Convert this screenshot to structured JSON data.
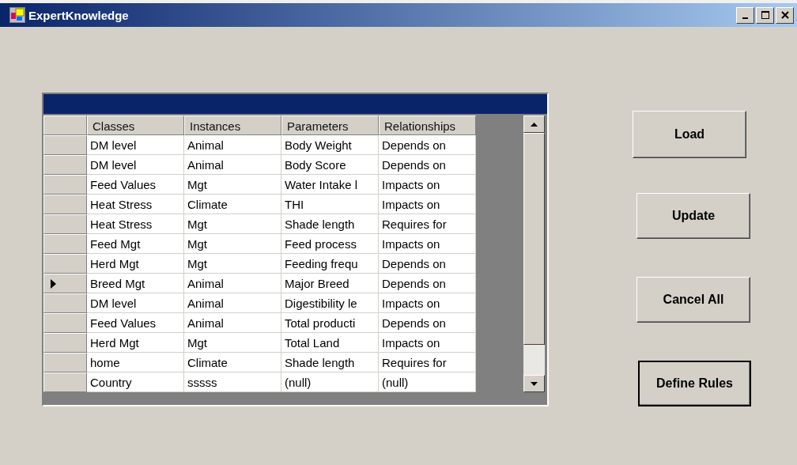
{
  "window": {
    "title": "ExpertKnowledge"
  },
  "table": {
    "columns": [
      "Classes",
      "Instances",
      "Parameters",
      "Relationships"
    ],
    "rows": [
      {
        "selected": false,
        "cells": [
          "DM level",
          "Animal",
          "Body Weight",
          "Depends on"
        ]
      },
      {
        "selected": false,
        "cells": [
          "DM level",
          "Animal",
          "Body Score",
          "Depends on"
        ]
      },
      {
        "selected": false,
        "cells": [
          "Feed Values",
          "Mgt",
          "Water Intake l",
          "Impacts on"
        ]
      },
      {
        "selected": false,
        "cells": [
          "Heat Stress",
          "Climate",
          "THI",
          "Impacts on"
        ]
      },
      {
        "selected": false,
        "cells": [
          "Heat Stress",
          "Mgt",
          "Shade length",
          "Requires for"
        ]
      },
      {
        "selected": false,
        "cells": [
          "Feed Mgt",
          "Mgt",
          "Feed process",
          "Impacts on"
        ]
      },
      {
        "selected": false,
        "cells": [
          "Herd Mgt",
          "Mgt",
          "Feeding frequ",
          "Depends on"
        ]
      },
      {
        "selected": true,
        "cells": [
          "Breed Mgt",
          "Animal",
          "Major Breed",
          "Depends on"
        ]
      },
      {
        "selected": false,
        "cells": [
          "DM level",
          "Animal",
          "Digestibility le",
          "Impacts on"
        ]
      },
      {
        "selected": false,
        "cells": [
          "Feed Values",
          "Animal",
          "Total producti",
          "Depends on"
        ]
      },
      {
        "selected": false,
        "cells": [
          "Herd Mgt",
          "Mgt",
          "Total Land",
          "Impacts on"
        ]
      },
      {
        "selected": false,
        "cells": [
          "home",
          "Climate",
          "Shade length",
          "Requires for"
        ]
      },
      {
        "selected": false,
        "cells": [
          "Country",
          "sssss",
          "(null)",
          "(null)"
        ]
      }
    ]
  },
  "buttons": [
    {
      "label": "Load",
      "default": false
    },
    {
      "label": "Update",
      "default": false
    },
    {
      "label": "Cancel All",
      "default": false
    },
    {
      "label": "Define Rules",
      "default": true
    }
  ]
}
